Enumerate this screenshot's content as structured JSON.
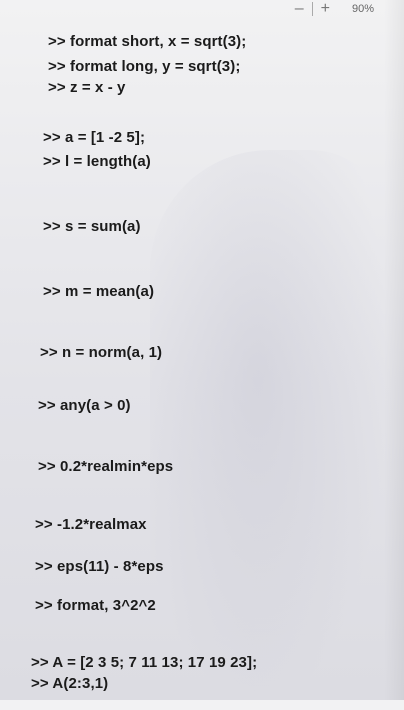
{
  "zoom": {
    "minus": "–",
    "plus": "+",
    "level": "90%"
  },
  "commands": [
    ">> format short, x = sqrt(3);",
    ">> format long, y = sqrt(3);",
    ">> z = x - y",
    ">> a = [1 -2 5];",
    ">> l = length(a)",
    ">> s = sum(a)",
    ">> m = mean(a)",
    ">> n = norm(a, 1)",
    ">> any(a > 0)",
    ">> 0.2*realmin*eps",
    ">> -1.2*realmax",
    ">> eps(11) - 8*eps",
    ">> format, 3^2^2",
    ">> A = [2 3 5; 7 11 13; 17 19 23];",
    ">> A(2:3,1)"
  ]
}
